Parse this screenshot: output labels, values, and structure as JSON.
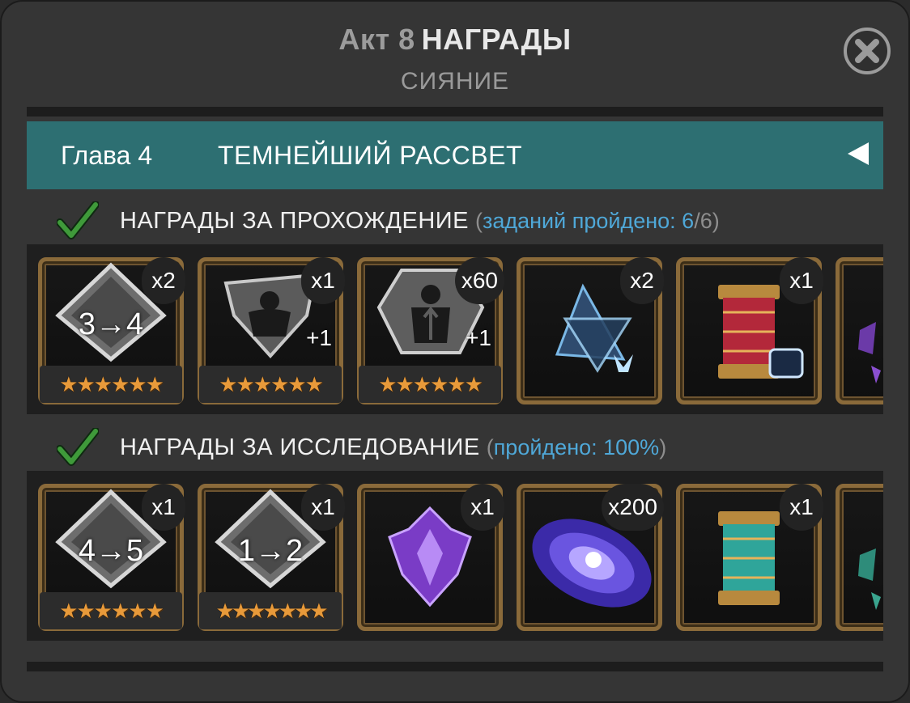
{
  "header": {
    "act": "Акт 8",
    "title": "НАГРАДЫ",
    "subtitle": "СИЯНИЕ"
  },
  "chapter": {
    "number": "Глава 4",
    "name": "ТЕМНЕЙШИЙ РАССВЕТ"
  },
  "sections": [
    {
      "label": "НАГРАДЫ ЗА ПРОХОЖДЕНИЕ",
      "info_prefix": "заданий пройдено: ",
      "info_value": "6",
      "info_total": "/6",
      "items": [
        {
          "icon": "crystal-upgrade-icon",
          "count": "x2",
          "text": "3→4",
          "stars": "★★★★★★"
        },
        {
          "icon": "sig-stone-skill-icon",
          "count": "x1",
          "plus": "+1",
          "stars": "★★★★★★"
        },
        {
          "icon": "sig-stone-mutant-icon",
          "count": "x60",
          "plus": "+1",
          "stars": "★★★★★★"
        },
        {
          "icon": "cosmic-shard-icon",
          "count": "x2"
        },
        {
          "icon": "crystal-capsule-red-icon",
          "count": "x1"
        }
      ]
    },
    {
      "label": "НАГРАДЫ ЗА ИССЛЕДОВАНИЕ",
      "info_prefix": "пройдено: ",
      "info_value": "100%",
      "info_total": "",
      "items": [
        {
          "icon": "crystal-upgrade-icon",
          "count": "x1",
          "text": "4→5",
          "stars": "★★★★★★"
        },
        {
          "icon": "crystal-upgrade-icon",
          "count": "x1",
          "text": "1→2",
          "stars": "★★★★★★★"
        },
        {
          "icon": "purple-crystal-icon",
          "count": "x1"
        },
        {
          "icon": "galaxy-icon",
          "count": "x200"
        },
        {
          "icon": "crystal-capsule-teal-icon",
          "count": "x1"
        }
      ]
    }
  ],
  "colors": {
    "accent": "#2d6f72",
    "info": "#4fa8d8",
    "star": "#e89a3a",
    "frame": "#8a6a3a"
  }
}
